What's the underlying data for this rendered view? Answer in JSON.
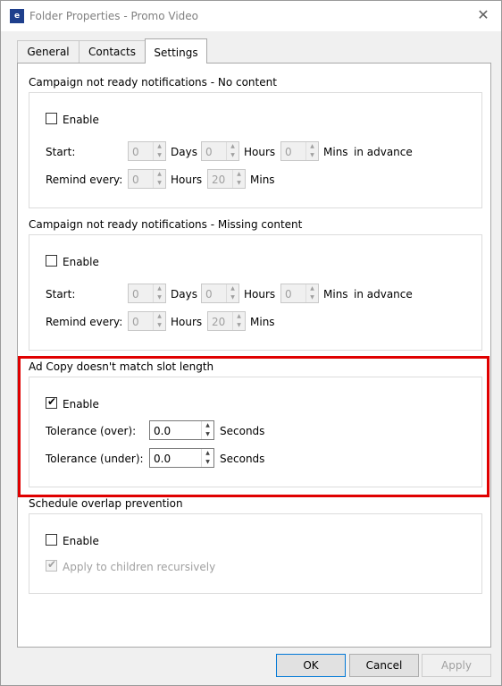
{
  "window": {
    "title": "Folder Properties - Promo Video",
    "app_icon": "doc-app-icon"
  },
  "tabs": [
    {
      "label": "General",
      "active": false
    },
    {
      "label": "Contacts",
      "active": false
    },
    {
      "label": "Settings",
      "active": true
    }
  ],
  "sections": {
    "no_content": {
      "title": "Campaign not ready notifications - No content",
      "enable_label": "Enable",
      "enabled": false,
      "start_label": "Start:",
      "days_value": "0",
      "days_label": "Days",
      "hours_value": "0",
      "hours_label": "Hours",
      "mins_value": "0",
      "mins_label": "Mins",
      "in_advance_label": "in advance",
      "remind_label": "Remind every:",
      "remind_hours_value": "0",
      "remind_hours_label": "Hours",
      "remind_mins_value": "20",
      "remind_mins_label": "Mins"
    },
    "missing_content": {
      "title": "Campaign not ready notifications - Missing content",
      "enable_label": "Enable",
      "enabled": false,
      "start_label": "Start:",
      "days_value": "0",
      "days_label": "Days",
      "hours_value": "0",
      "hours_label": "Hours",
      "mins_value": "0",
      "mins_label": "Mins",
      "in_advance_label": "in advance",
      "remind_label": "Remind every:",
      "remind_hours_value": "0",
      "remind_hours_label": "Hours",
      "remind_mins_value": "20",
      "remind_mins_label": "Mins"
    },
    "ad_copy": {
      "title": "Ad Copy doesn't match slot length",
      "enable_label": "Enable",
      "enabled": true,
      "tol_over_label": "Tolerance (over):",
      "tol_over_value": "0.0",
      "tol_under_label": "Tolerance (under):",
      "tol_under_value": "0.0",
      "seconds_label": "Seconds",
      "highlight_color": "#e00000"
    },
    "schedule_overlap": {
      "title": "Schedule overlap prevention",
      "enable_label": "Enable",
      "enabled": false,
      "children_label": "Apply to children recursively",
      "children_checked": true
    }
  },
  "buttons": {
    "ok": "OK",
    "cancel": "Cancel",
    "apply": "Apply"
  }
}
